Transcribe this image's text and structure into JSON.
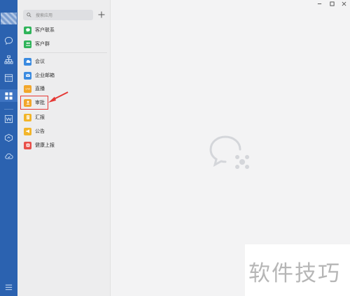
{
  "search": {
    "placeholder": "搜索应用"
  },
  "apps": [
    {
      "label": "客户联系",
      "icon": "chat-bubble-icon",
      "color": "#2fb45a"
    },
    {
      "label": "客户群",
      "icon": "group-icon",
      "color": "#2fb45a"
    },
    {
      "label": "会议",
      "icon": "cloud-meeting-icon",
      "color": "#3b8be0"
    },
    {
      "label": "企业邮箱",
      "icon": "mail-icon",
      "color": "#3b8be0"
    },
    {
      "label": "直播",
      "icon": "live-icon",
      "color": "#f2a62a"
    },
    {
      "label": "审批",
      "icon": "approval-person-icon",
      "color": "#f2a62a"
    },
    {
      "label": "汇报",
      "icon": "report-doc-icon",
      "color": "#f2b52a"
    },
    {
      "label": "公告",
      "icon": "megaphone-icon",
      "color": "#f2b52a"
    },
    {
      "label": "健康上报",
      "icon": "health-plus-icon",
      "color": "#e8504a"
    }
  ],
  "highlighted_app": "审批",
  "watermark": {
    "text": "软件技巧"
  },
  "colors": {
    "rail": "#2b62b0",
    "highlight": "#e53935"
  }
}
